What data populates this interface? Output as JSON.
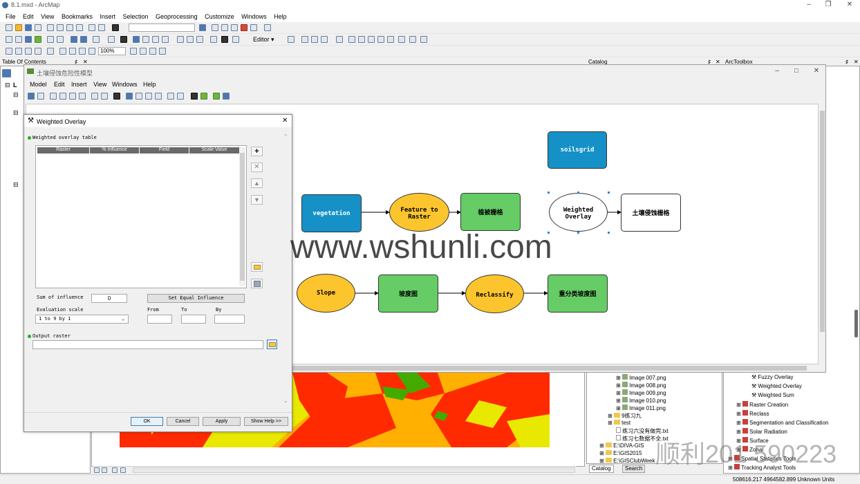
{
  "app": {
    "title": "8.1.mxd - ArcMap",
    "menu": [
      "File",
      "Edit",
      "View",
      "Bookmarks",
      "Insert",
      "Selection",
      "Geoprocessing",
      "Customize",
      "Windows",
      "Help"
    ],
    "zoom_value": "100%",
    "editor_label": "Editor ▾"
  },
  "panels": {
    "toc_title": "Table Of Contents",
    "catalog_title": "Catalog",
    "arctoolbox_title": "ArcToolbox",
    "catalog_tabs": [
      "Catalog",
      "Search"
    ],
    "status_coords": "508616.217  4964582.899 Unknown Units"
  },
  "catalog_tree": [
    {
      "label": "Image 007.png"
    },
    {
      "label": "Image 008.png"
    },
    {
      "label": "Image 009.png"
    },
    {
      "label": "Image 010.png"
    },
    {
      "label": "Image 011.png"
    },
    {
      "label": "9练习九"
    },
    {
      "label": "test"
    },
    {
      "label": "练习六没有做完.txt"
    },
    {
      "label": "练习七数据不全.txt"
    },
    {
      "label": "E:\\DIVA-GIS"
    },
    {
      "label": "E:\\GIS2015"
    },
    {
      "label": "E:\\GISClubWeek"
    }
  ],
  "toolbox_tree": [
    {
      "label": "Fuzzy Overlay"
    },
    {
      "label": "Weighted Overlay"
    },
    {
      "label": "Weighted Sum"
    },
    {
      "label": "Raster Creation"
    },
    {
      "label": "Reclass"
    },
    {
      "label": "Segmentation and Classification"
    },
    {
      "label": "Solar Radiation"
    },
    {
      "label": "Surface"
    },
    {
      "label": "Zonal"
    },
    {
      "label": "Spatial Statistics Tools"
    },
    {
      "label": "Tracking Analyst Tools"
    }
  ],
  "model_builder": {
    "title": "土壤侵蚀危险性模型",
    "menu": [
      "Model",
      "Edit",
      "Insert",
      "View",
      "Windows",
      "Help"
    ],
    "nodes": {
      "soilsgrid": "soilsgrid",
      "vegetation": "vegetation",
      "feature_to_raster": "Feature to Raster",
      "veg_raster": "植被栅格",
      "weighted_overlay": "Weighted Overlay",
      "erosion_raster": "土壤侵蚀栅格",
      "slope": "Slope",
      "slope_map": "坡度图",
      "reclassify": "Reclassify",
      "reclass_slope": "重分类坡度图"
    }
  },
  "dialog": {
    "title": "Weighted Overlay",
    "section_table": "Weighted overlay table",
    "columns": [
      "Raster",
      "% Influence",
      "Field",
      "Scale Value"
    ],
    "sum_label": "Sum of influence",
    "sum_value": "0",
    "equal_button": "Set Equal Influence",
    "eval_label": "Evaluation scale",
    "eval_value": "1   to   9   by   1",
    "from_label": "From",
    "to_label": "To",
    "by_label": "By",
    "output_label": "Output raster",
    "buttons": {
      "ok": "OK",
      "cancel": "Cancel",
      "apply": "Apply",
      "help": "Show Help >>"
    }
  },
  "watermark": {
    "main": "www.wshunli.com",
    "corner": "顺利201  590223"
  }
}
